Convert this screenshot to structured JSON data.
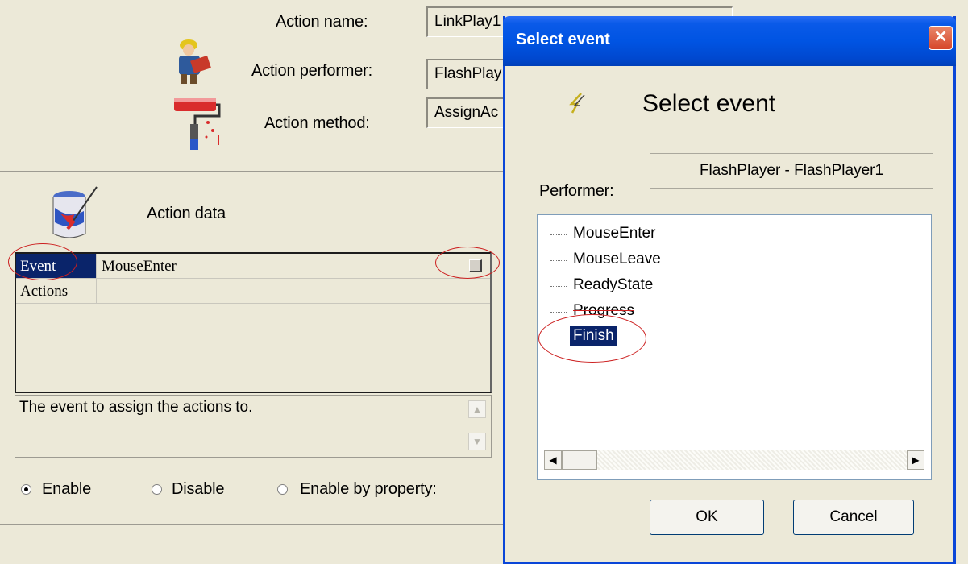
{
  "form": {
    "action_name_label": "Action name:",
    "action_name_value": "LinkPlay1",
    "action_performer_label": "Action performer:",
    "action_performer_value": "FlashPlay",
    "action_method_label": "Action method:",
    "action_method_value": "AssignAc",
    "action_data_label": "Action data"
  },
  "grid": {
    "rows": [
      {
        "name": "Event",
        "value": "MouseEnter"
      },
      {
        "name": "Actions",
        "value": ""
      }
    ]
  },
  "description": "The event to assign the actions to.",
  "radios": {
    "enable": "Enable",
    "disable": "Disable",
    "by_property": "Enable by property:",
    "selected": "enable"
  },
  "dialog": {
    "title": "Select event",
    "heading": "Select event",
    "performer_label": "Performer:",
    "performer_value": "FlashPlayer - FlashPlayer1",
    "events": [
      "MouseEnter",
      "MouseLeave",
      "ReadyState",
      "Progress",
      "Finish"
    ],
    "selected_event": "Finish",
    "ok": "OK",
    "cancel": "Cancel",
    "close_icon": "x-icon",
    "selection_color": "#0a246a",
    "annotation_color": "#cc1f1f"
  }
}
